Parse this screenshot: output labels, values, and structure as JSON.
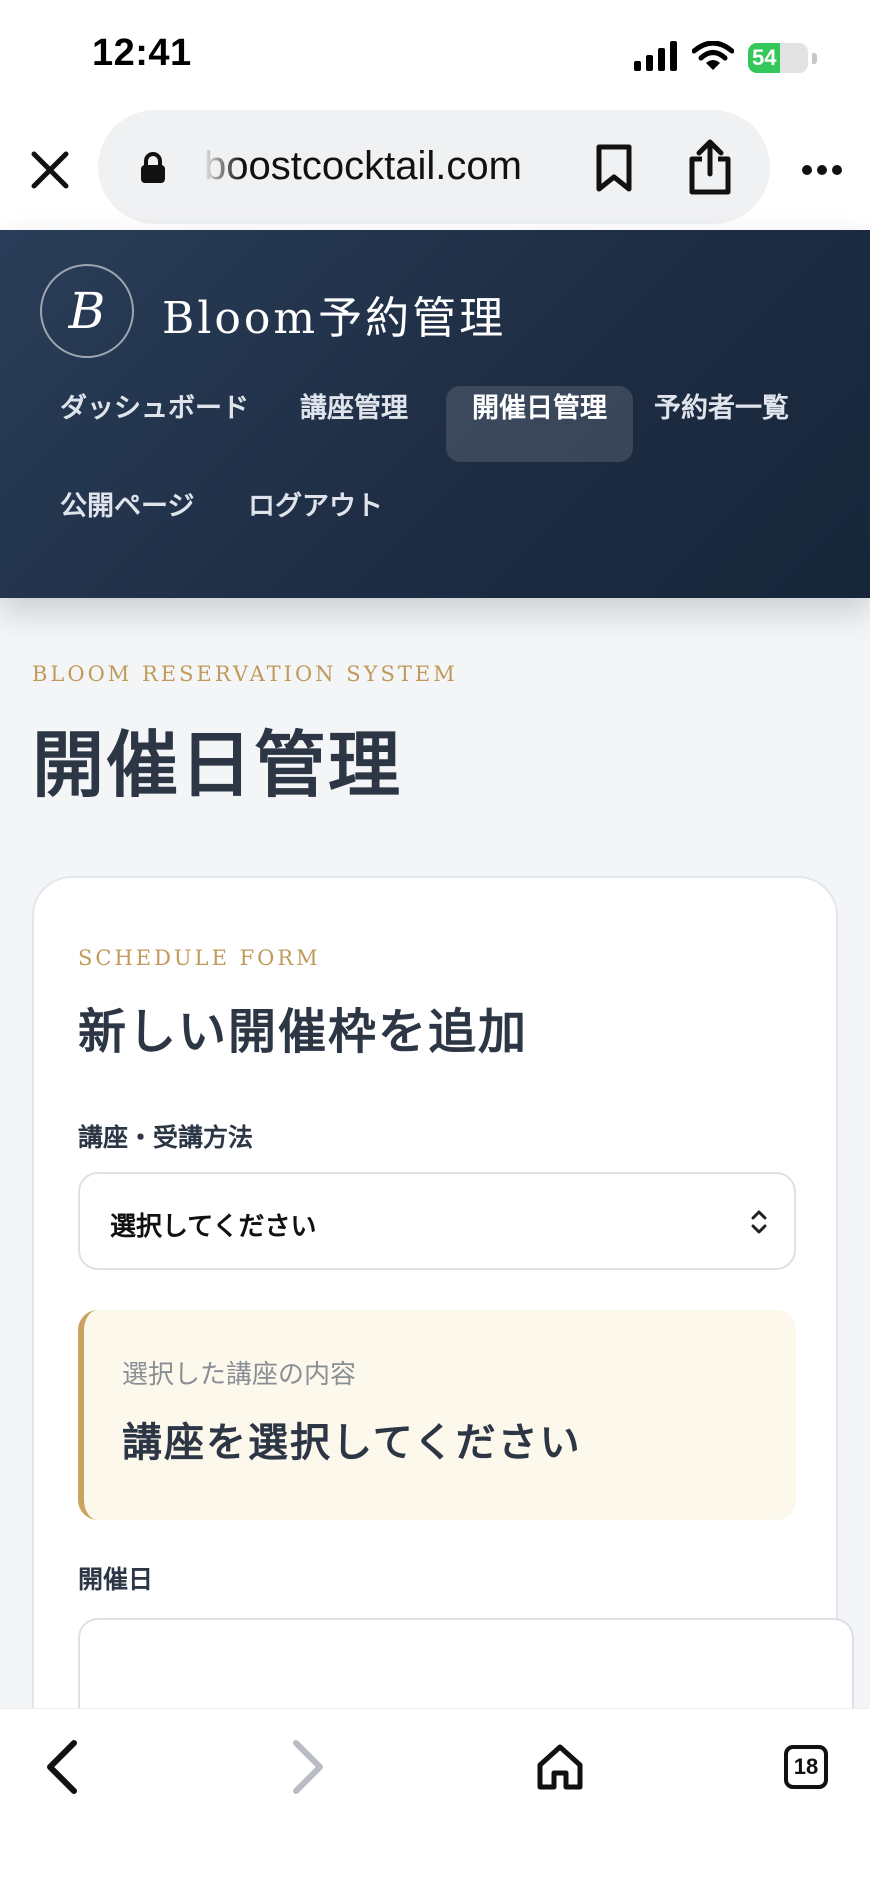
{
  "status_bar": {
    "time": "12:41",
    "battery_level": "54",
    "battery_fraction": 0.54
  },
  "browser": {
    "url": "boostcocktail.com",
    "tabs_count": "18"
  },
  "site": {
    "logo_letter": "B",
    "brand": "Bloom予約管理",
    "nav": [
      {
        "label": "ダッシュボード",
        "active": false
      },
      {
        "label": "講座管理",
        "active": false
      },
      {
        "label": "開催日管理",
        "active": true
      },
      {
        "label": "予約者一覧",
        "active": false
      },
      {
        "label": "公開ページ",
        "active": false
      },
      {
        "label": "ログアウト",
        "active": false
      }
    ]
  },
  "page": {
    "eyebrow": "BLOOM RESERVATION SYSTEM",
    "title": "開催日管理"
  },
  "form": {
    "eyebrow": "SCHEDULE FORM",
    "title": "新しい開催枠を追加",
    "course_label": "講座・受講方法",
    "course_select_value": "選択してください",
    "info_caption": "選択した講座の内容",
    "info_value": "講座を選択してください",
    "date_label": "開催日",
    "date_value": ""
  },
  "colors": {
    "header_bg": "#1f2f45",
    "accent_gold": "#c09a5a",
    "info_bg": "#fdf8ec",
    "text_dark": "#2c3644",
    "battery_green": "#34c759"
  }
}
